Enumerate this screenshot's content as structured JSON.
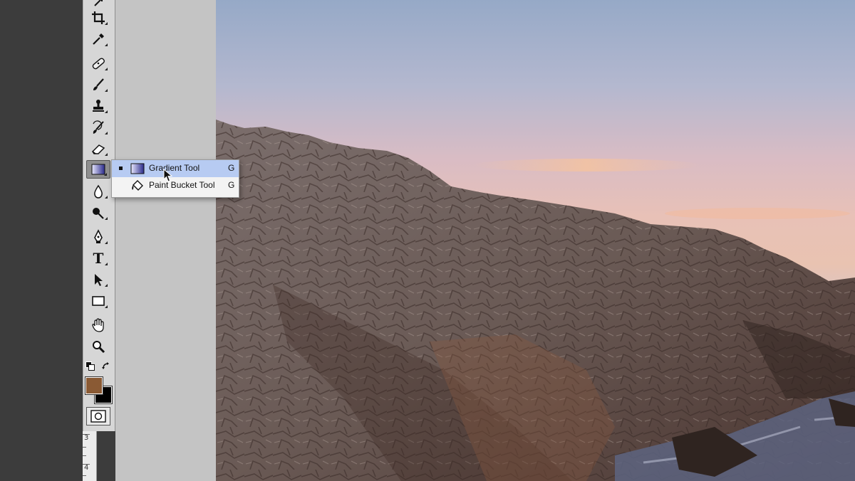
{
  "toolbar": {
    "tools": [
      {
        "name": "move-tool-partial",
        "icon": "move-icon"
      },
      {
        "name": "crop-tool",
        "icon": "crop-icon"
      },
      {
        "name": "eyedropper-tool",
        "icon": "eyedropper-icon"
      },
      {
        "name": "healing-brush-tool",
        "icon": "bandage-icon"
      },
      {
        "name": "brush-tool",
        "icon": "brush-icon"
      },
      {
        "name": "clone-stamp-tool",
        "icon": "stamp-icon"
      },
      {
        "name": "history-brush-tool",
        "icon": "history-brush-icon"
      },
      {
        "name": "eraser-tool",
        "icon": "eraser-icon"
      },
      {
        "name": "gradient-tool",
        "icon": "gradient-icon",
        "selected": true
      },
      {
        "name": "blur-tool",
        "icon": "drop-icon"
      },
      {
        "name": "dodge-tool",
        "icon": "dodge-icon"
      },
      {
        "name": "pen-tool",
        "icon": "pen-icon"
      },
      {
        "name": "type-tool",
        "icon": "type-icon"
      },
      {
        "name": "path-selection-tool",
        "icon": "arrow-icon"
      },
      {
        "name": "shape-tool",
        "icon": "rectangle-icon"
      },
      {
        "name": "hand-tool",
        "icon": "hand-icon"
      },
      {
        "name": "zoom-tool",
        "icon": "magnifier-icon"
      }
    ],
    "type_glyph": "T",
    "foreground_color": "#8a5a34",
    "background_color": "#000000"
  },
  "flyout": {
    "items": [
      {
        "label": "Gradient Tool",
        "shortcut": "G",
        "icon": "gradient-icon",
        "active": true
      },
      {
        "label": "Paint Bucket Tool",
        "shortcut": "G",
        "icon": "paint-bucket-icon",
        "active": false
      }
    ]
  },
  "ruler": {
    "labels": [
      "3",
      "4"
    ]
  },
  "canvas": {
    "subject": "rocky-cliff-photo",
    "sky_colors": [
      "#96a9c7",
      "#e8c1b7"
    ],
    "rock_color": "#6b5850"
  }
}
